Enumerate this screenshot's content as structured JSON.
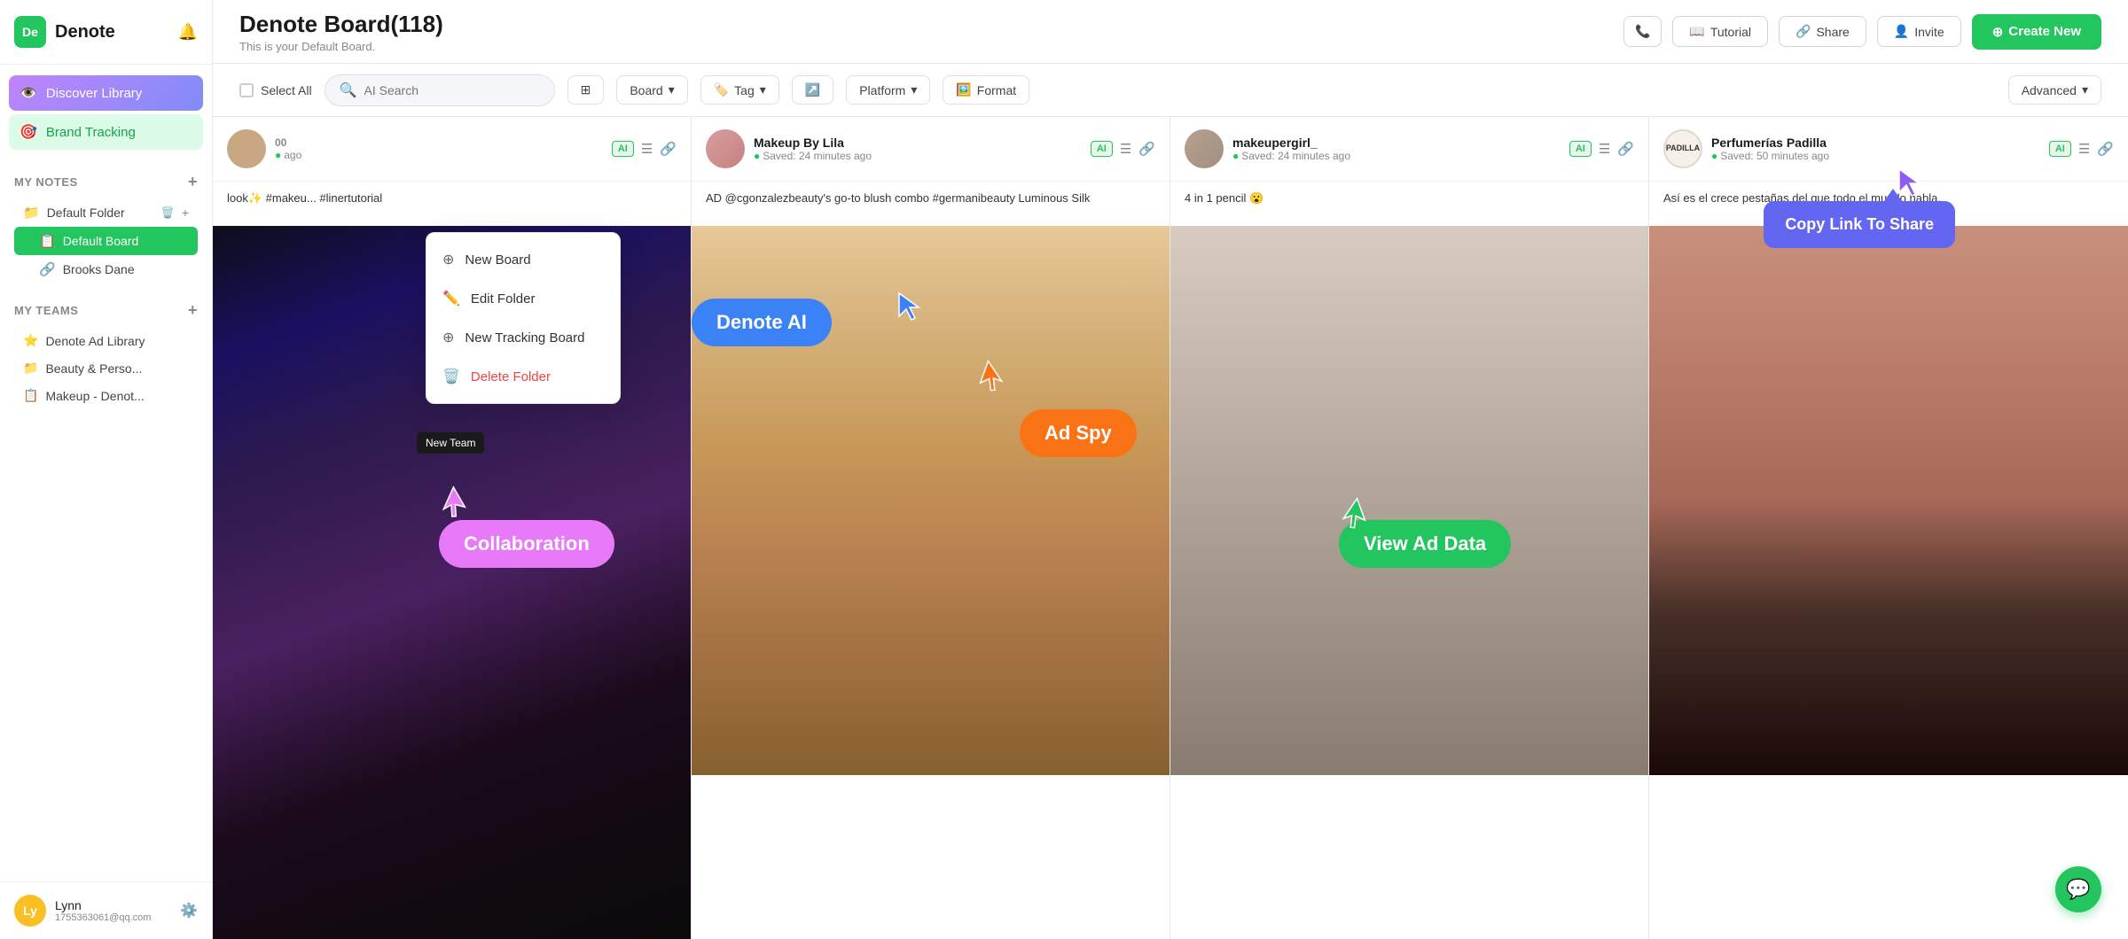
{
  "app": {
    "logo_text": "De",
    "name": "Denote",
    "bell_icon": "🔔"
  },
  "sidebar": {
    "nav_items": [
      {
        "id": "discover-library",
        "label": "Discover Library",
        "icon": "👁️",
        "active": true
      },
      {
        "id": "brand-tracking",
        "label": "Brand Tracking",
        "icon": "🎯",
        "active_green": true
      }
    ],
    "my_notes_label": "My Notes",
    "folders": [
      {
        "id": "default-folder",
        "label": "Default Folder",
        "icon": "📁"
      }
    ],
    "boards": [
      {
        "id": "default-board",
        "label": "Default Board",
        "icon": "📋",
        "selected": true
      }
    ],
    "other_items": [
      {
        "id": "brooks-dane",
        "label": "Brooks Dane",
        "icon": "🔗"
      }
    ],
    "my_teams_label": "My Teams",
    "teams": [
      {
        "id": "denote-ad-library",
        "label": "Denote Ad Library",
        "icon": "⭐"
      },
      {
        "id": "beauty-perso",
        "label": "Beauty & Perso...",
        "icon": "📁"
      },
      {
        "id": "makeup-denot",
        "label": "Makeup - Denot...",
        "icon": "📋"
      }
    ],
    "footer": {
      "initials": "Ly",
      "name": "Lynn",
      "email": "1755363061@qq.com",
      "gear_icon": "⚙️"
    }
  },
  "topbar": {
    "title": "Denote Board(118)",
    "subtitle": "This is your Default Board.",
    "btn_tutorial": "Tutorial",
    "btn_share": "Share",
    "btn_invite": "Invite",
    "btn_create_new": "Create New",
    "phone_icon": "📞",
    "tutorial_icon": "📖",
    "share_icon": "🔗",
    "invite_icon": "👤"
  },
  "toolbar": {
    "select_all_label": "Select All",
    "search_placeholder": "AI Search",
    "board_label": "Board",
    "tag_label": "Tag",
    "platform_label": "Platform",
    "format_label": "Format",
    "advanced_label": "Advanced",
    "grid_icon": "⊞",
    "tag_icon": "🏷️",
    "share_icon": "↗️",
    "chevron_icon": "▾"
  },
  "dropdown_menu": {
    "items": [
      {
        "id": "new-board",
        "label": "New Board",
        "icon": "⊕",
        "danger": false
      },
      {
        "id": "edit-folder",
        "label": "Edit Folder",
        "icon": "✏️",
        "danger": false
      },
      {
        "id": "new-tracking-board",
        "label": "New Tracking Board",
        "icon": "⊕",
        "danger": false
      },
      {
        "id": "delete-folder",
        "label": "Delete Folder",
        "icon": "🗑️",
        "danger": true
      }
    ]
  },
  "cards": [
    {
      "id": "card-1",
      "username": "",
      "saved_text": "ago",
      "caption": "look✨ #makeu... #linertutorial",
      "bg_class": "face-img-1"
    },
    {
      "id": "card-2",
      "username": "Makeup By Lila",
      "saved_text": "Saved: 24 minutes ago",
      "caption": "AD @cgonzalezbeauty's go-to blush combo #germanibeauty Luminous Silk",
      "bg_class": "face-img-2"
    },
    {
      "id": "card-3",
      "username": "makeupergirl_",
      "saved_text": "Saved: 24 minutes ago",
      "caption": "4 in 1 pencil 😮",
      "bg_class": "face-img-3"
    },
    {
      "id": "card-4",
      "username": "Perfumerías Padilla",
      "saved_text": "Saved: 50 minutes ago",
      "caption": "Así es el crece pestañas del que todo el mundo habla.",
      "bg_class": "face-img-4"
    }
  ],
  "callouts": {
    "denote_ai": "Denote AI",
    "ad_spy": "Ad Spy",
    "collaboration": "Collaboration",
    "view_ad_data": "View Ad Data",
    "copy_link": "Copy Link To Share",
    "new_team_tooltip": "New Team"
  },
  "chat": {
    "icon": "💬"
  }
}
